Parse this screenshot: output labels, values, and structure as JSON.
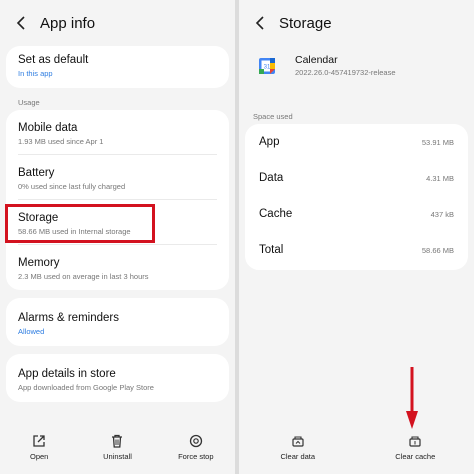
{
  "left": {
    "title": "App info",
    "default": {
      "label": "Set as default",
      "sub": "In this app"
    },
    "usage_label": "Usage",
    "usage": [
      {
        "label": "Mobile data",
        "sub": "1.93 MB used since Apr 1"
      },
      {
        "label": "Battery",
        "sub": "0% used since last fully charged"
      },
      {
        "label": "Storage",
        "sub": "58.66 MB used in Internal storage"
      },
      {
        "label": "Memory",
        "sub": "2.3 MB used on average in last 3 hours"
      }
    ],
    "alarms": {
      "label": "Alarms & reminders",
      "sub": "Allowed"
    },
    "details": {
      "label": "App details in store",
      "sub": "App downloaded from Google Play Store"
    },
    "bottom": [
      {
        "label": "Open",
        "icon": "open-icon"
      },
      {
        "label": "Uninstall",
        "icon": "trash-icon"
      },
      {
        "label": "Force stop",
        "icon": "stop-icon"
      }
    ]
  },
  "right": {
    "title": "Storage",
    "app": {
      "name": "Calendar",
      "version": "2022.26.0-457419732-release",
      "icon": "calendar-app-icon"
    },
    "space_label": "Space used",
    "rows": [
      {
        "label": "App",
        "value": "53.91 MB"
      },
      {
        "label": "Data",
        "value": "4.31 MB"
      },
      {
        "label": "Cache",
        "value": "437 kB"
      },
      {
        "label": "Total",
        "value": "58.66 MB"
      }
    ],
    "bottom": [
      {
        "label": "Clear data",
        "icon": "clear-data-icon"
      },
      {
        "label": "Clear cache",
        "icon": "clear-cache-icon"
      }
    ]
  },
  "colors": {
    "highlight": "#d3121f",
    "link": "#2e7de1"
  }
}
